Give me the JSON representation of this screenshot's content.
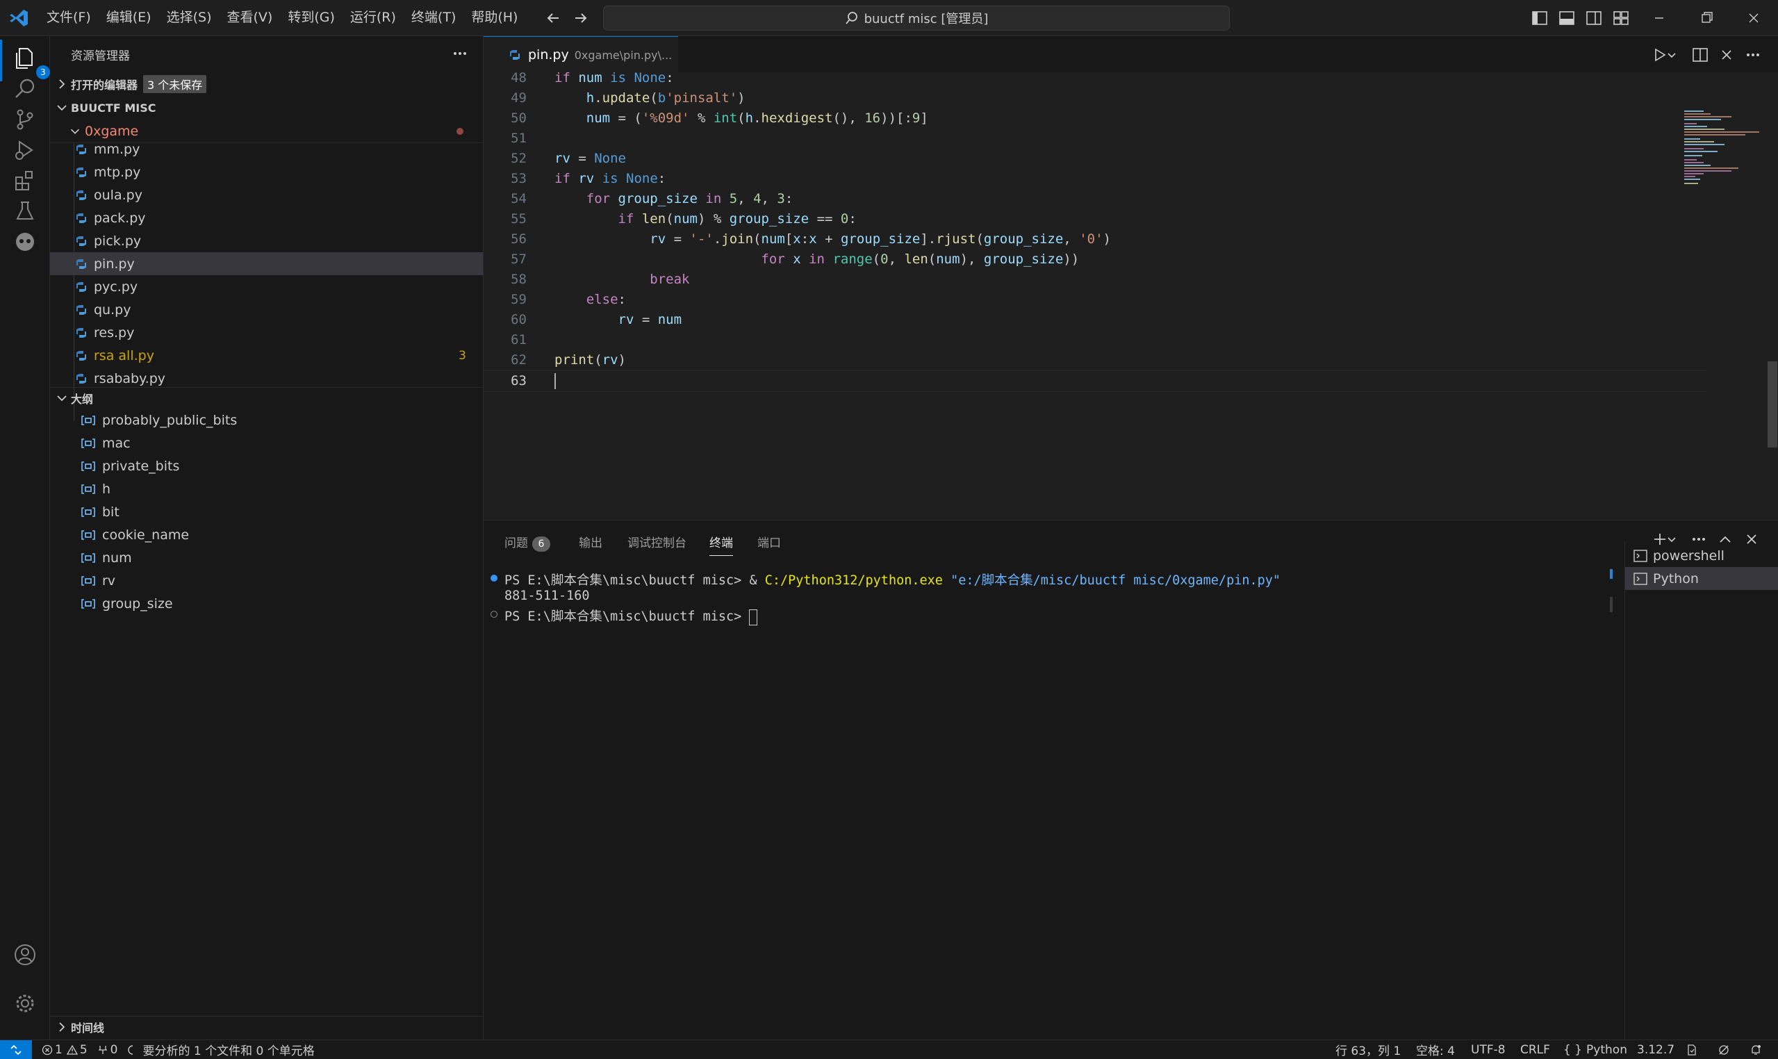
{
  "titlebar": {
    "menus": [
      "文件(F)",
      "编辑(E)",
      "选择(S)",
      "查看(V)",
      "转到(G)",
      "运行(R)",
      "终端(T)",
      "帮助(H)"
    ],
    "search_text": "buuctf misc [管理员]"
  },
  "activity": {
    "explorer_badge": "3",
    "icons": [
      "explorer-icon",
      "search-icon",
      "source-control-icon",
      "run-debug-icon",
      "extensions-icon",
      "testing-icon",
      "copilot-icon",
      "account-icon",
      "settings-gear-icon"
    ]
  },
  "sidebar": {
    "title": "资源管理器",
    "open_editors_label": "打开的编辑器",
    "unsaved_badge": "3 个未保存",
    "workspace_label": "BUUCTF MISC",
    "folder_name": "0xgame",
    "files": [
      {
        "name": "mm.py"
      },
      {
        "name": "mtp.py"
      },
      {
        "name": "oula.py"
      },
      {
        "name": "pack.py"
      },
      {
        "name": "pick.py"
      },
      {
        "name": "pin.py"
      },
      {
        "name": "pyc.py"
      },
      {
        "name": "qu.py"
      },
      {
        "name": "res.py"
      },
      {
        "name": "rsa all.py",
        "errors": "3"
      },
      {
        "name": "rsababy.py"
      }
    ],
    "outline_label": "大纲",
    "outline_items": [
      "probably_public_bits",
      "mac",
      "private_bits",
      "h",
      "bit",
      "cookie_name",
      "num",
      "rv",
      "group_size"
    ],
    "timeline_label": "时间线"
  },
  "editor": {
    "tab_label": "pin.py",
    "tab_description": "0xgame\\pin.py\\...",
    "line_numbers": [
      "48",
      "49",
      "50",
      "51",
      "52",
      "53",
      "54",
      "55",
      "56",
      "57",
      "58",
      "59",
      "60",
      "61",
      "62",
      "63"
    ],
    "current_line": "63"
  },
  "panel": {
    "tabs": [
      "问题",
      "输出",
      "调试控制台",
      "终端",
      "端口"
    ],
    "problems_count": "6",
    "active_tab": "终端",
    "terminal": {
      "prompt1": "PS E:\\脚本合集\\misc\\buuctf misc> ",
      "cmd_amp": "& ",
      "cmd_exe": "C:/Python312/python.exe",
      "cmd_arg": "\"e:/脚本合集/misc/buuctf misc/0xgame/pin.py\"",
      "output": "881-511-160",
      "prompt2": "PS E:\\脚本合集\\misc\\buuctf misc> "
    },
    "terminal_list": [
      "powershell",
      "Python"
    ]
  },
  "statusbar": {
    "errors": "1",
    "warnings": "5",
    "ports": "0",
    "analysis": "要分析的 1 个文件和 0 个单元格",
    "position": "行 63，列 1",
    "spaces": "空格: 4",
    "encoding": "UTF-8",
    "eol": "CRLF",
    "language": "Python",
    "version": "3.12.7"
  },
  "colors": {
    "accent": "#0078d4",
    "folder_modified": "#f48771",
    "warning": "#cca700"
  }
}
